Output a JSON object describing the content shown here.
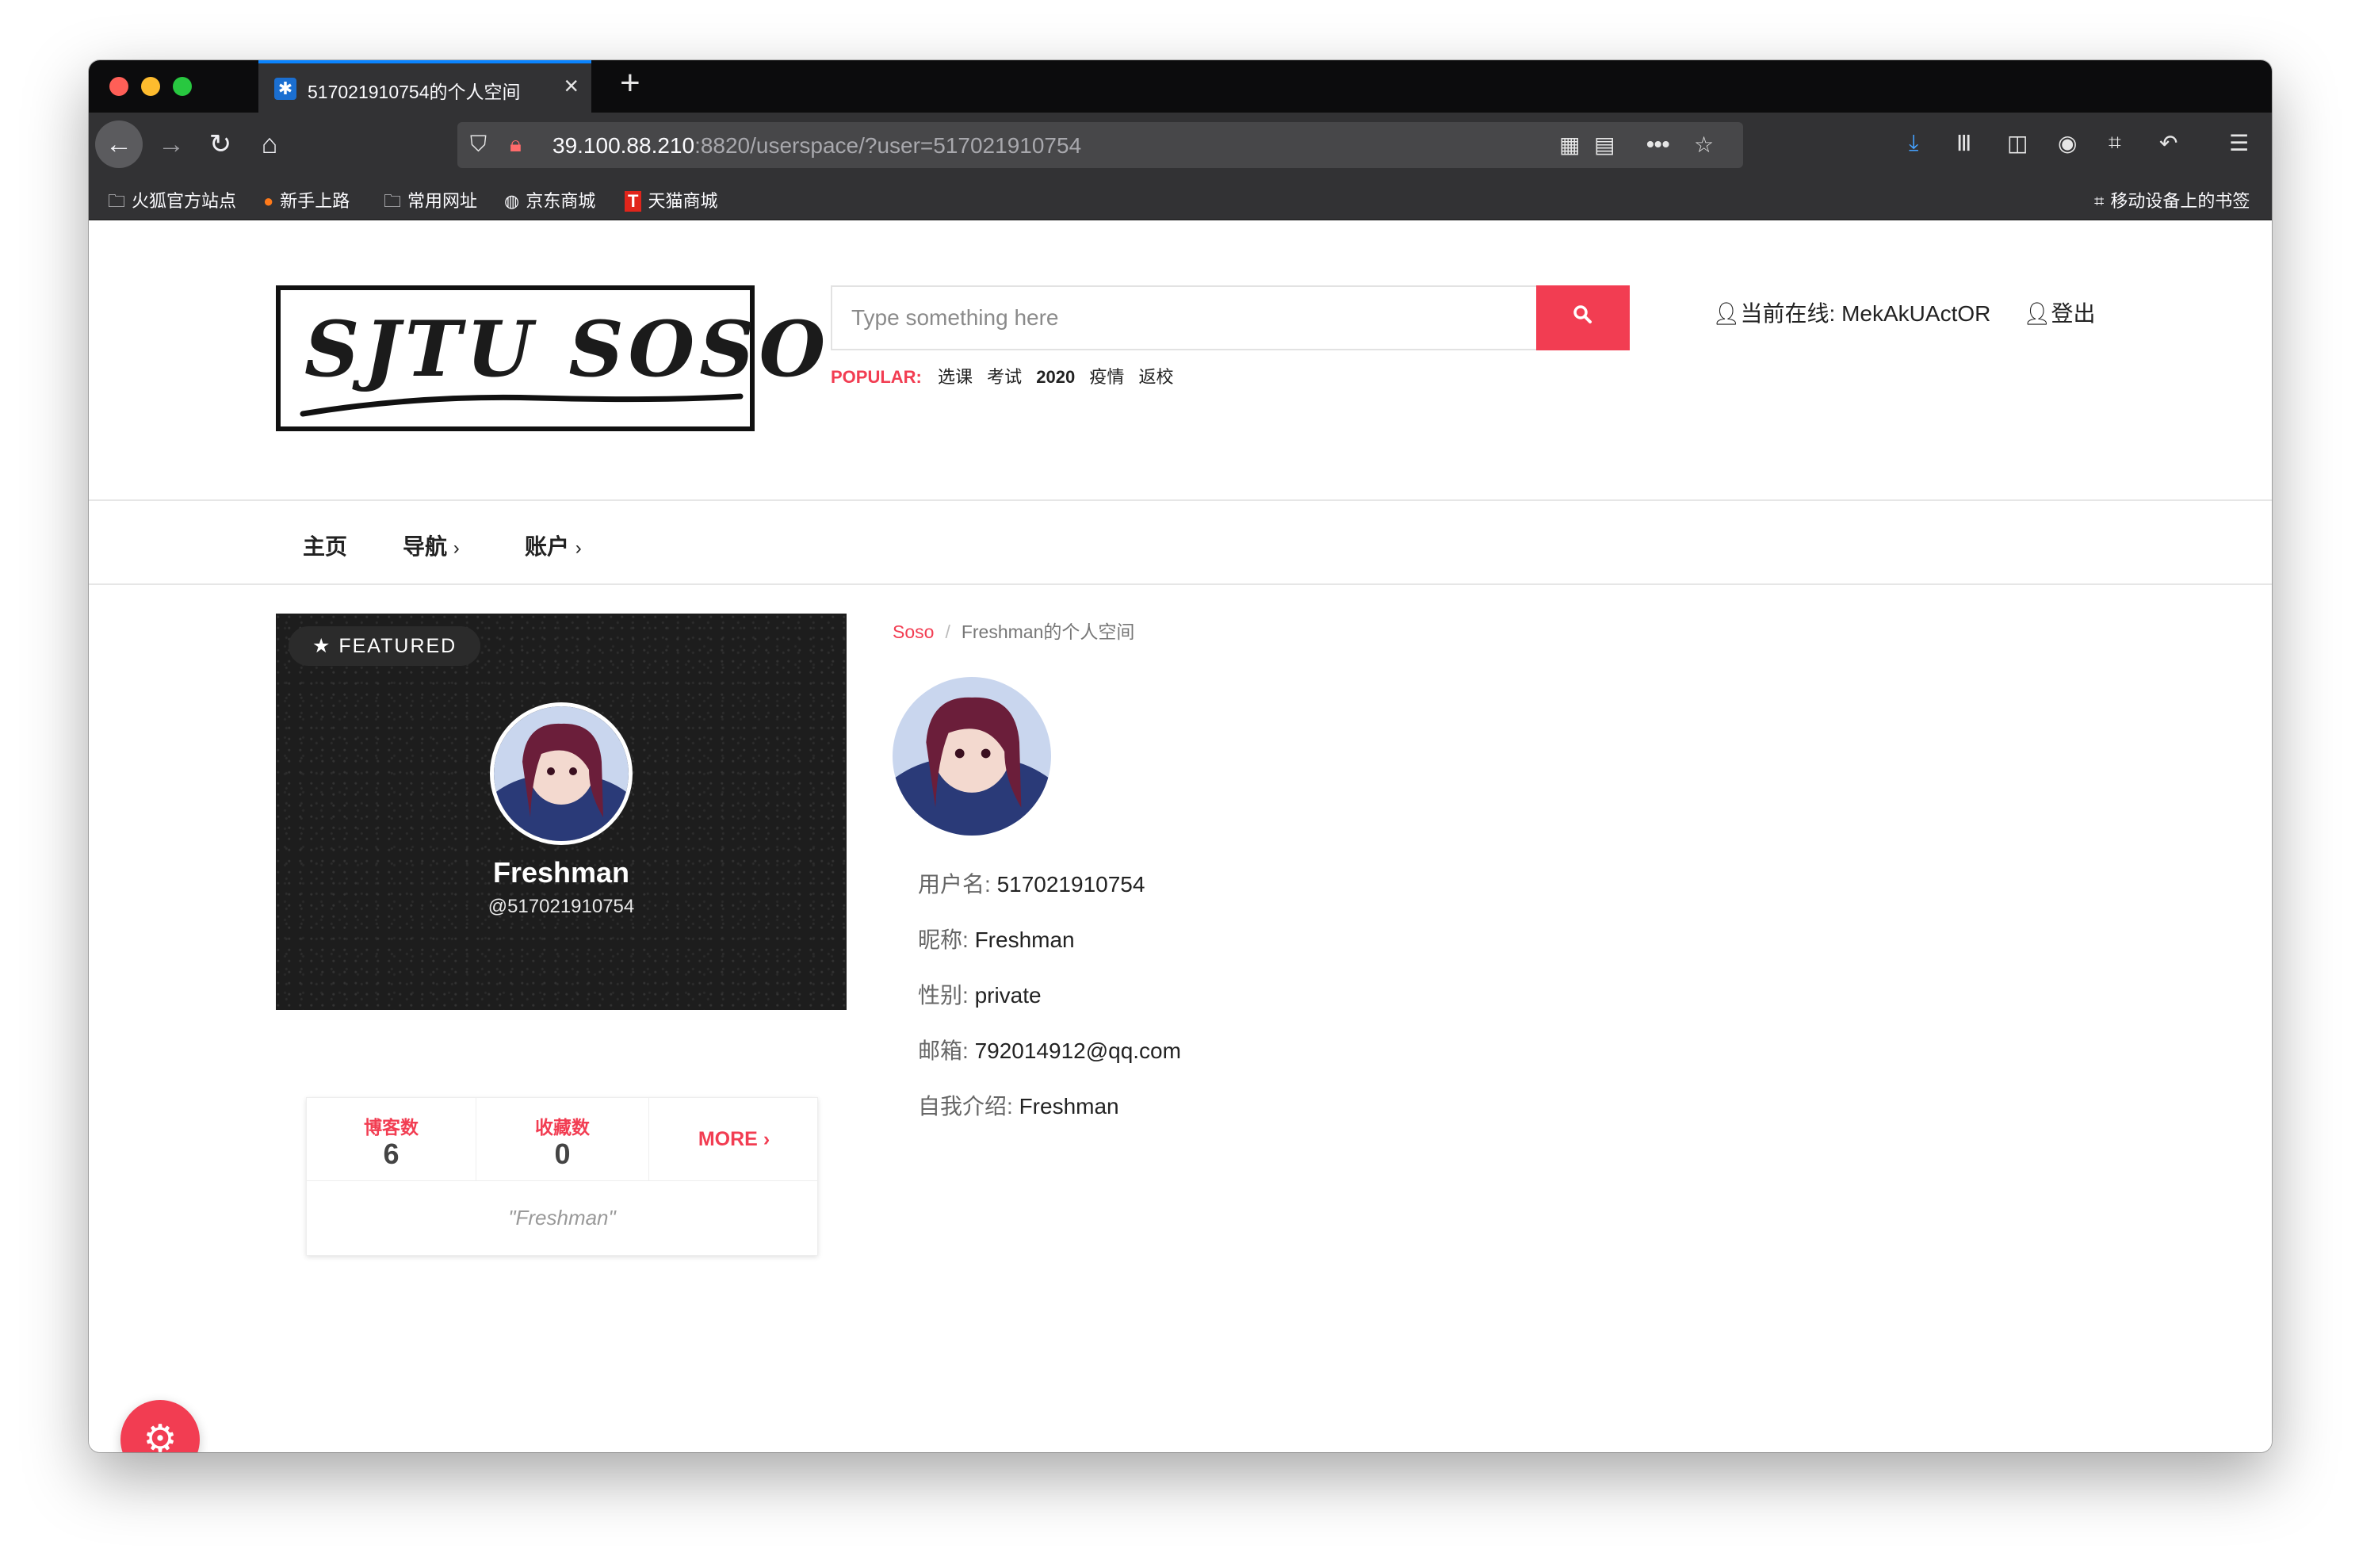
{
  "browser": {
    "tab_title": "517021910754的个人空间",
    "url_host": "39.100.88.210",
    "url_rest": ":8820/userspace/?user=517021910754",
    "bookmarks": [
      "火狐官方站点",
      "新手上路",
      "常用网址",
      "京东商城",
      "天猫商城"
    ],
    "mobile_bookmarks": "移动设备上的书签"
  },
  "header": {
    "logo_text": "SJTU SOSO",
    "search_placeholder": "Type something here",
    "popular_label": "POPULAR:",
    "popular_tags": [
      "选课",
      "考试",
      "2020",
      "疫情",
      "返校"
    ],
    "online_label": "当前在线:",
    "online_user": "MekAkUActOR",
    "logout_label": "登出"
  },
  "menu": {
    "items": [
      "主页",
      "导航",
      "账户"
    ]
  },
  "card": {
    "featured_label": "★ FEATURED",
    "name": "Freshman",
    "handle": "@517021910754",
    "stats": [
      {
        "label": "博客数",
        "value": "6"
      },
      {
        "label": "收藏数",
        "value": "0"
      }
    ],
    "more_label": "MORE",
    "quote": "\"Freshman\""
  },
  "profile": {
    "breadcrumb_home": "Soso",
    "breadcrumb_current": "Freshman的个人空间",
    "fields": [
      {
        "key": "用户名:",
        "value": "517021910754"
      },
      {
        "key": "昵称:",
        "value": "Freshman"
      },
      {
        "key": "性别:",
        "value": "private"
      },
      {
        "key": "邮箱:",
        "value": "792014912@qq.com"
      },
      {
        "key": "自我介绍:",
        "value": "Freshman"
      }
    ]
  },
  "colors": {
    "accent": "#f23d52",
    "browser_chrome": "#323234",
    "tab_bar": "#0c0c0d"
  }
}
